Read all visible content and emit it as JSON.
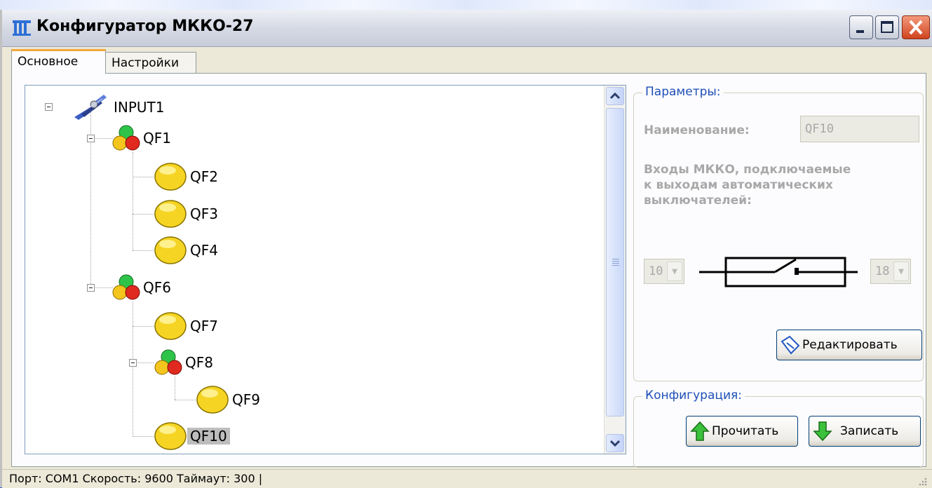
{
  "window": {
    "title": "Конфигуратор МККО-27"
  },
  "tabs": [
    {
      "label": "Основное",
      "active": true
    },
    {
      "label": "Настройки",
      "active": false
    }
  ],
  "tree": {
    "nodes": [
      {
        "label": "INPUT1",
        "icon": "satellite-icon"
      },
      {
        "label": "QF1",
        "icon": "rgb-balls-icon"
      },
      {
        "label": "QF2",
        "icon": "yellow-ball-icon"
      },
      {
        "label": "QF3",
        "icon": "yellow-ball-icon"
      },
      {
        "label": "QF4",
        "icon": "yellow-ball-icon"
      },
      {
        "label": "QF6",
        "icon": "rgb-balls-icon"
      },
      {
        "label": "QF7",
        "icon": "yellow-ball-icon"
      },
      {
        "label": "QF8",
        "icon": "rgb-balls-icon"
      },
      {
        "label": "QF9",
        "icon": "yellow-ball-icon"
      },
      {
        "label": "QF10",
        "icon": "yellow-ball-icon",
        "selected": true
      }
    ]
  },
  "params": {
    "title": "Параметры:",
    "name_label": "Наименование:",
    "name_value": "QF10",
    "inputs_label_line1": "Входы МККО, подключаемые",
    "inputs_label_line2": "к выходам автоматических",
    "inputs_label_line3": "выключателей:",
    "left_input": "10",
    "right_input": "18",
    "edit_button": "Редактировать"
  },
  "config": {
    "title": "Конфигурация:",
    "read_button": "Прочитать",
    "write_button": "Записать"
  },
  "status": {
    "text": "Порт: COM1 Скорость: 9600 Таймаут: 300 |"
  },
  "colors": {
    "accent": "#1f4fb6",
    "selection": "#bdbdbd",
    "tab_highlight": "#f3a83b"
  }
}
